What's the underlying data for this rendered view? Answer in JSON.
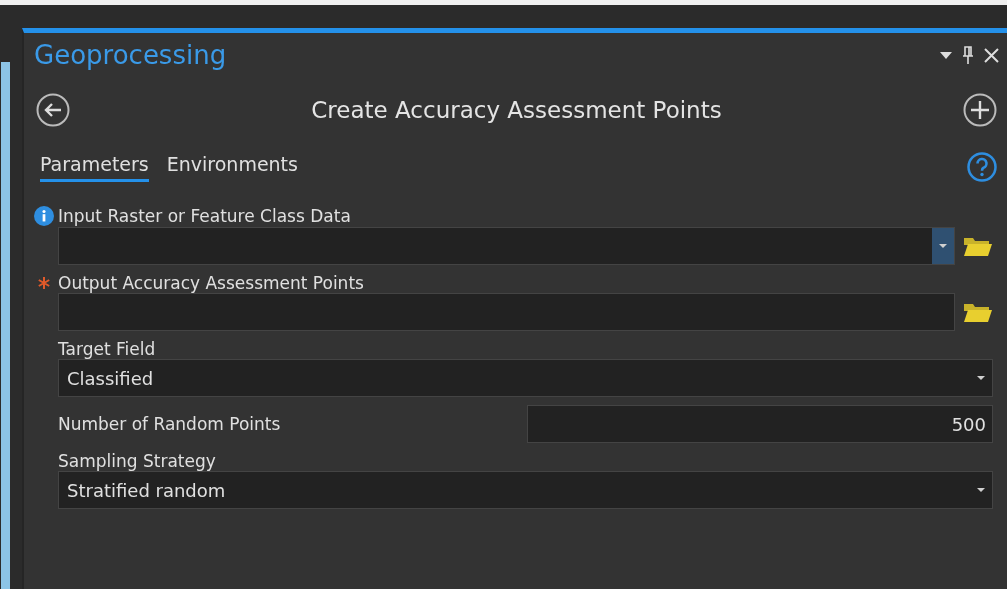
{
  "pane": {
    "title": "Geoprocessing",
    "tool_title": "Create Accuracy Assessment Points"
  },
  "tabs": [
    {
      "label": "Parameters",
      "selected": true
    },
    {
      "label": "Environments",
      "selected": false
    }
  ],
  "parameters": [
    {
      "kind": "combo",
      "info": true,
      "required": false,
      "label": "Input Raster or Feature Class Data",
      "browse": true
    },
    {
      "kind": "text",
      "info": false,
      "required": true,
      "label": "Output Accuracy Assessment Points",
      "browse": true
    },
    {
      "kind": "dropdown",
      "info": false,
      "required": false,
      "label": "Target Field",
      "value": "Classified",
      "browse": false
    },
    {
      "kind": "inline",
      "info": false,
      "required": false,
      "label": "Number of Random Points",
      "value": "500",
      "browse": false
    },
    {
      "kind": "dropdown",
      "info": false,
      "required": false,
      "label": "Sampling Strategy",
      "value": "Stratified random",
      "browse": false
    }
  ]
}
